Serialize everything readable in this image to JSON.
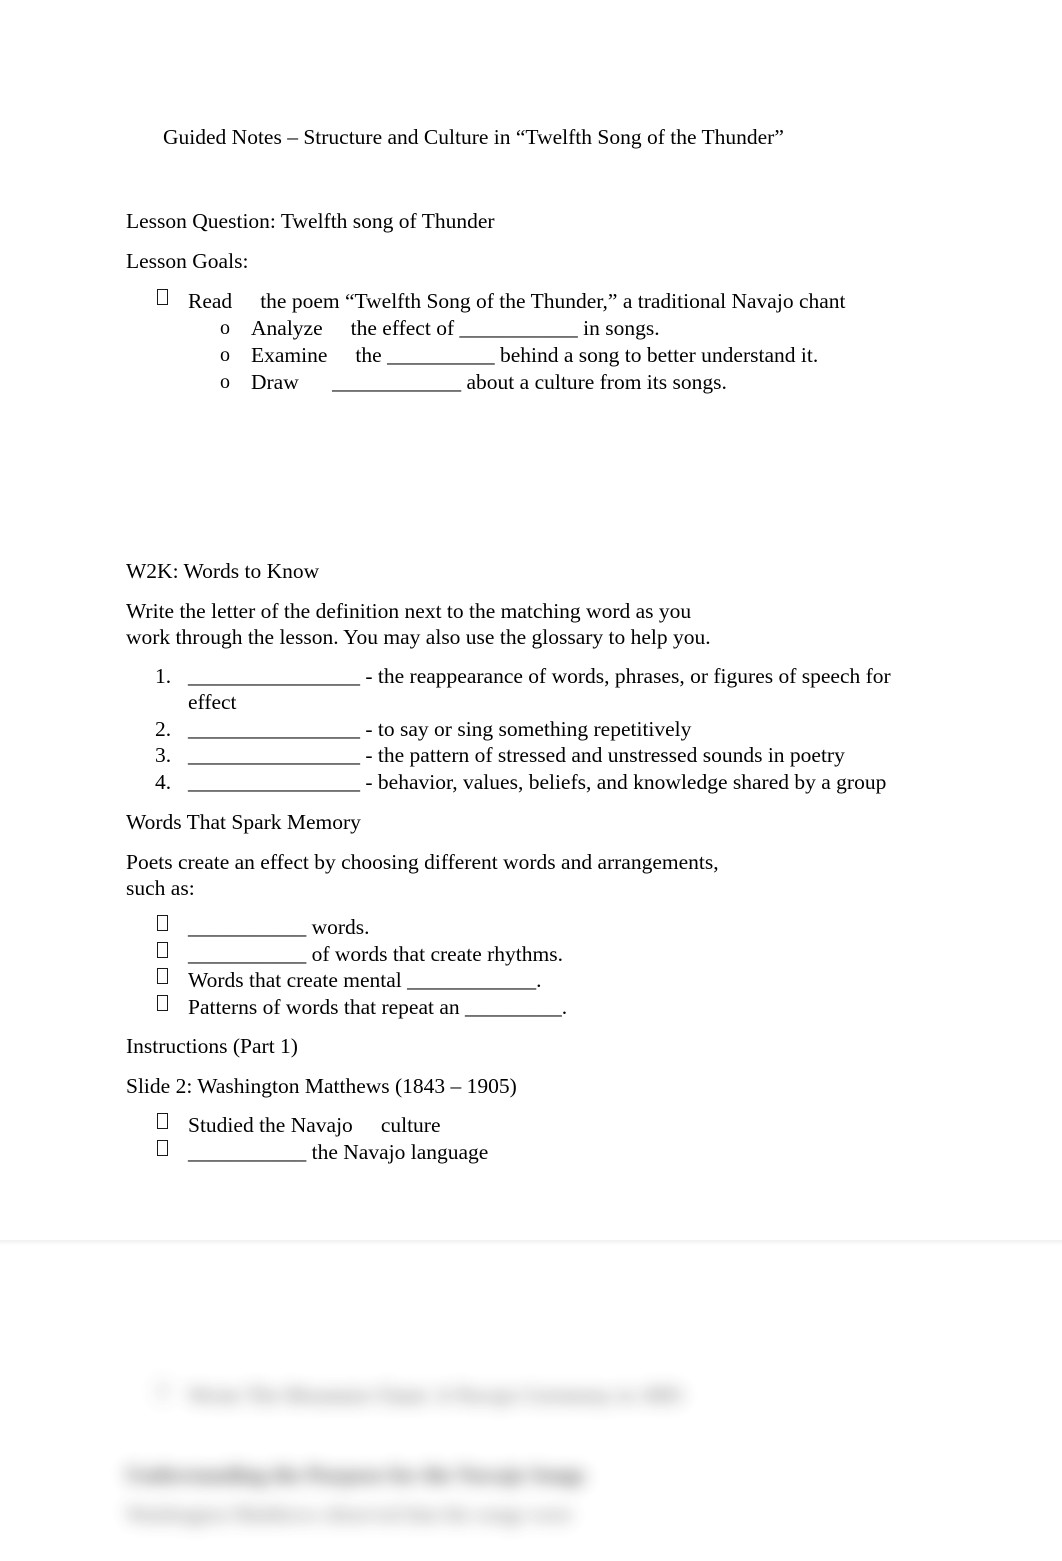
{
  "document": {
    "title": "Guided Notes – Structure and Culture in “Twelfth Song of the Thunder”",
    "lesson_question": "Lesson Question: Twelfth song of Thunder",
    "lesson_goals_label": "Lesson Goals:",
    "goals": {
      "main_bullet_lead": "Read",
      "main_bullet_text": "the poem “Twelfth Song of the Thunder,” a traditional Navajo chant",
      "sub_items": [
        {
          "marker": "o",
          "verb": "Analyze",
          "before": "the effect of",
          "blank": "___________",
          "after": "in songs."
        },
        {
          "marker": "o",
          "verb": "Examine",
          "before": "the",
          "blank": "__________",
          "after": "behind a song to better understand it."
        },
        {
          "marker": "o",
          "verb": "Draw",
          "before": "",
          "blank": "____________",
          "after": "about a culture from its songs."
        }
      ]
    },
    "w2k": {
      "heading": "W2K: Words to Know",
      "instructions": "Write the letter of the definition next to the matching word as you work through the lesson. You may also use the glossary to help you.",
      "items": [
        {
          "number": "1.",
          "blank": "________________",
          "definition": "- the reappearance of words, phrases, or figures of speech for effect"
        },
        {
          "number": "2.",
          "blank": "________________",
          "definition": "- to say or sing something repetitively"
        },
        {
          "number": "3.",
          "blank": "________________",
          "definition": "- the pattern of stressed and unstressed sounds in poetry"
        },
        {
          "number": "4.",
          "blank": "________________",
          "definition": "- behavior, values, beliefs, and knowledge shared by a group"
        }
      ]
    },
    "spark": {
      "heading": "Words That Spark Memory",
      "intro": "Poets create an effect by choosing different words and arrangements, such as:",
      "items": [
        {
          "blank": "___________",
          "text": "words.",
          "blank_first": true
        },
        {
          "blank": "___________",
          "text": "of words that create rhythms.",
          "blank_first": true
        },
        {
          "blank": "____________",
          "text": "Words that create mental",
          "blank_first": false,
          "trailing": "."
        },
        {
          "blank": "_________",
          "text": "Patterns of words that repeat an",
          "blank_first": false,
          "trailing": "."
        }
      ]
    },
    "instructions_heading": "Instructions (Part 1)",
    "slide2": {
      "heading": "Slide 2: Washington Matthews (1843 – 1905)",
      "items": [
        {
          "lead": "Studied the Navajo",
          "tail": "culture",
          "blank": ""
        },
        {
          "lead": "",
          "tail": "the Navajo language",
          "blank": "___________"
        }
      ]
    },
    "next_page_blurred": {
      "bullet": "Wrote The Mountain Chant: A Navajo Ceremony in 1883",
      "heading": "Understanding the Purpose for the Navajo Songs",
      "paragraph": "Washington Matthews observed that the songs were"
    }
  }
}
